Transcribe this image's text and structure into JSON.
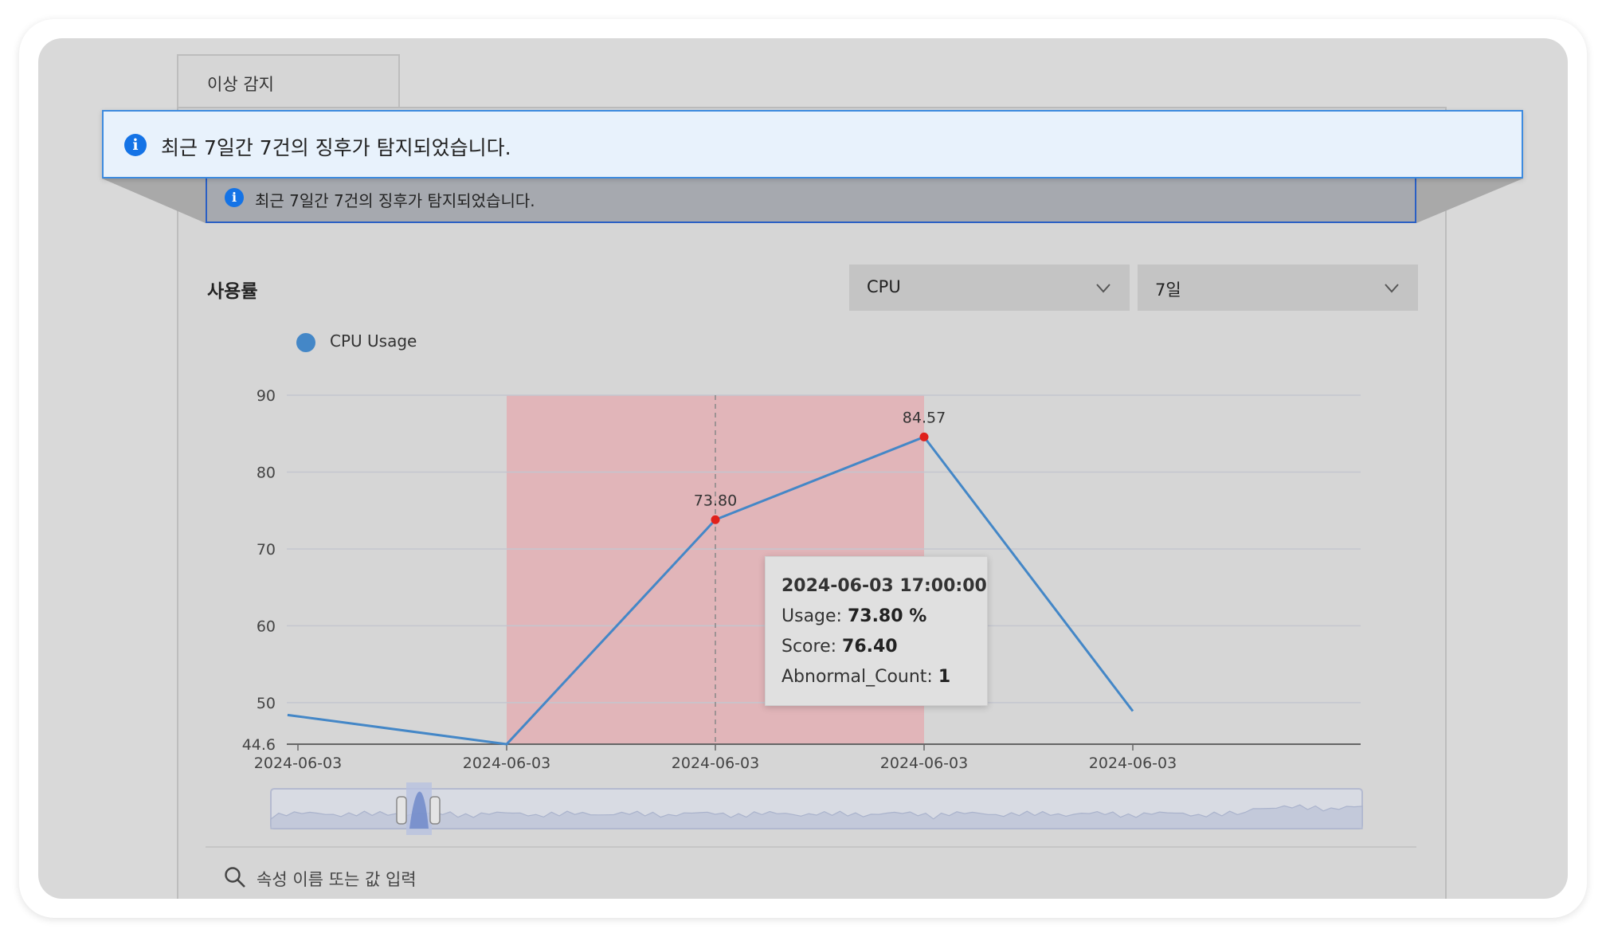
{
  "tab": {
    "label": "이상 감지"
  },
  "alert": {
    "message": "최근 7일간 7건의 징후가 탐지되었습니다.",
    "icon": "info-icon",
    "color": "#1473e6"
  },
  "section": {
    "title": "사용률"
  },
  "filters": {
    "metric": {
      "value": "CPU",
      "icon": "chevron-down-icon"
    },
    "period": {
      "value": "7일",
      "icon": "chevron-down-icon"
    }
  },
  "legend": {
    "label": "CPU Usage",
    "color": "#4487c7"
  },
  "tooltip": {
    "title": "2024-06-03 17:00:00",
    "usage_label": "Usage: ",
    "usage_value": "73.80 %",
    "score_label": "Score: ",
    "score_value": "76.40",
    "abnormal_label": "Abnormal_Count: ",
    "abnormal_value": "1"
  },
  "search": {
    "placeholder": "속성 이름 또는 값 입력",
    "icon": "search-icon"
  },
  "chart_data": {
    "type": "line",
    "series": [
      {
        "name": "CPU Usage",
        "color": "#4487c7"
      }
    ],
    "x": [
      0,
      1,
      2,
      3,
      4
    ],
    "values": [
      48.4,
      44.6,
      73.8,
      84.57,
      48.9
    ],
    "x_start_offset": -0.05,
    "tick_labels": [
      "2024-06-03",
      "2024-06-03",
      "2024-06-03",
      "2024-06-03",
      "2024-06-03"
    ],
    "y_ticks": [
      44.6,
      50,
      60,
      70,
      80,
      90
    ],
    "y_tick_labels": [
      "44.6",
      "50",
      "60",
      "70",
      "80",
      "90"
    ],
    "ylim": [
      44.6,
      90
    ],
    "xlim": [
      -0.05,
      5.05
    ],
    "point_labels": [
      {
        "index": 2,
        "text": "73.80"
      },
      {
        "index": 3,
        "text": "84.57"
      }
    ],
    "anomaly_points": [
      2,
      3
    ],
    "anomaly_point_color": "#e0201b",
    "highlight_range": [
      1,
      3
    ],
    "highlight_color": "#e4a9af",
    "crosshair_index": 2,
    "grid": true
  }
}
